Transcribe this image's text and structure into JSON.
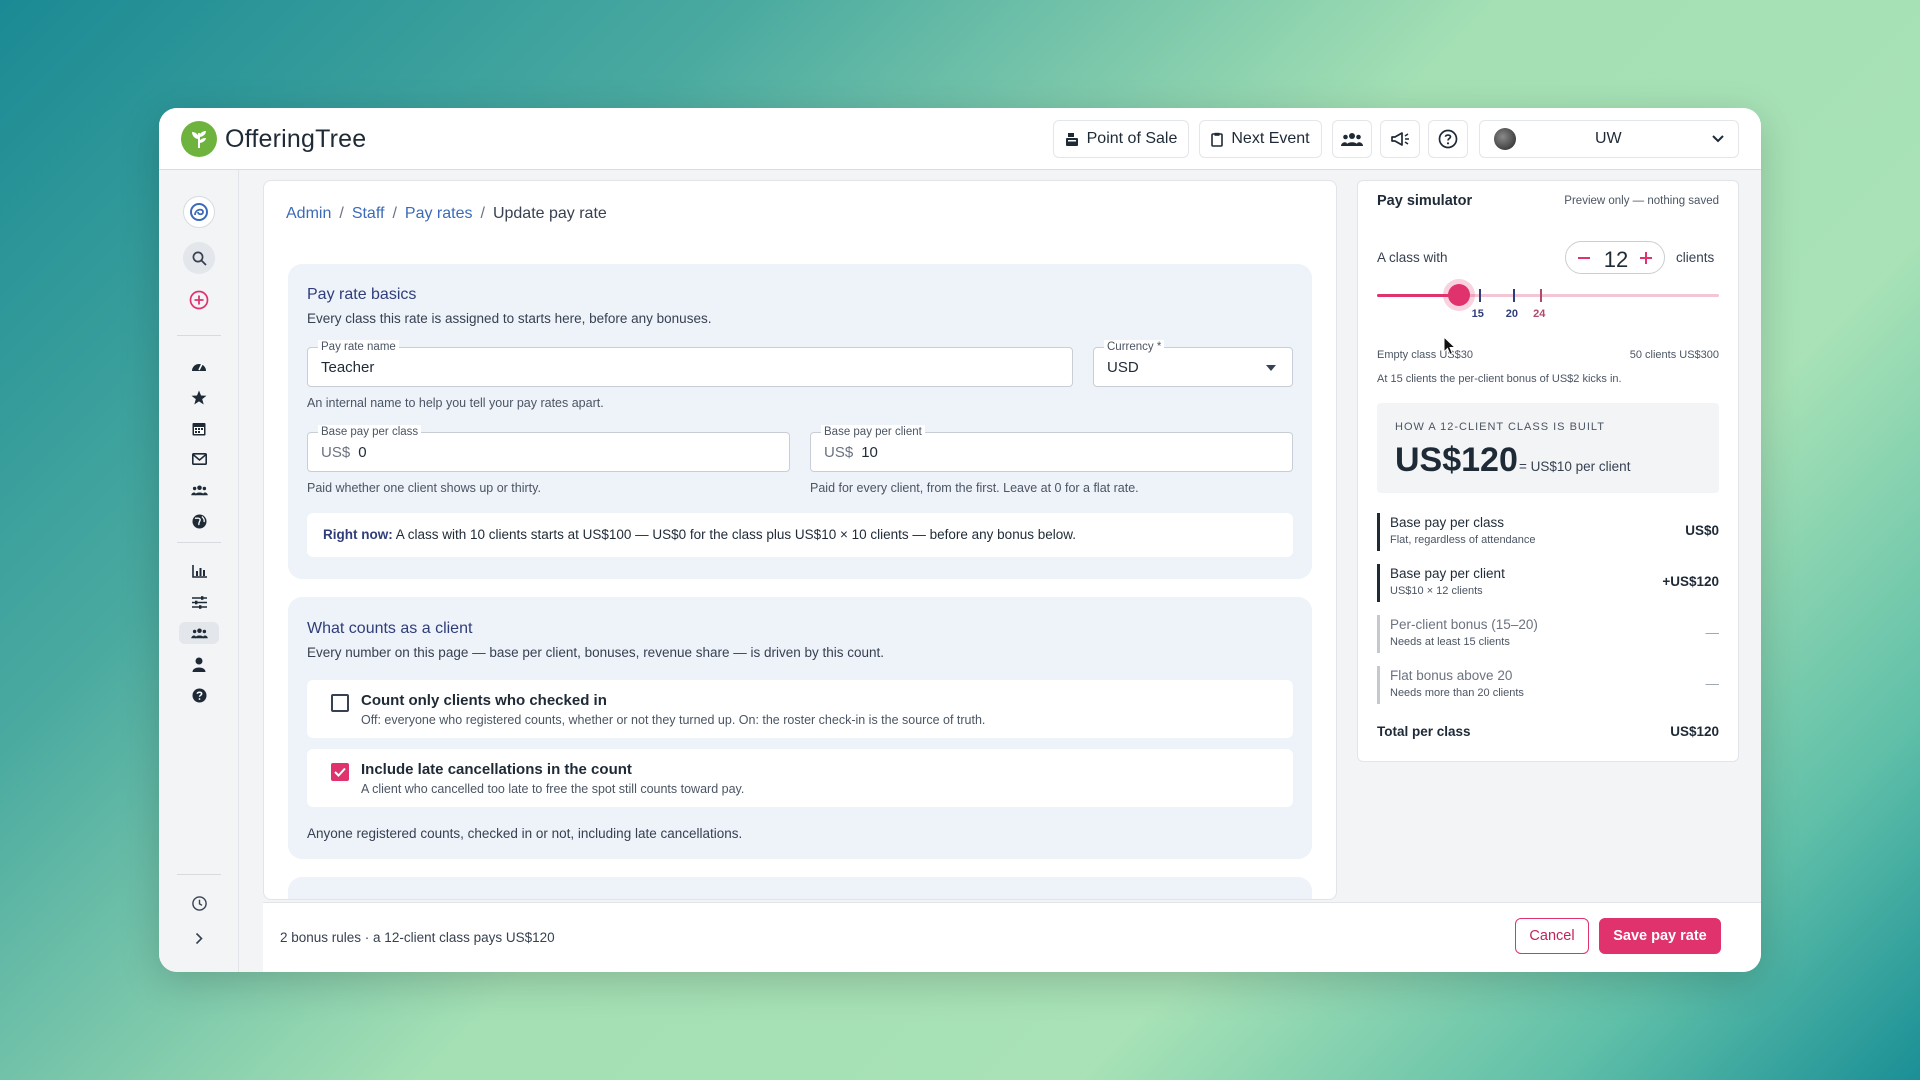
{
  "app": {
    "name": "OfferingTree"
  },
  "topbar": {
    "point_of_sale": "Point of Sale",
    "next_event": "Next Event",
    "user": "UW"
  },
  "breadcrumb": {
    "admin": "Admin",
    "staff": "Staff",
    "pay_rates": "Pay rates",
    "current": "Update pay rate"
  },
  "basics": {
    "title": "Pay rate basics",
    "subtitle": "Every class this rate is assigned to starts here, before any bonuses.",
    "name_label": "Pay rate name",
    "name_value": "Teacher",
    "name_help": "An internal name to help you tell your pay rates apart.",
    "currency_label": "Currency *",
    "currency_value": "USD",
    "base_class_label": "Base pay per class",
    "base_class_prefix": "US$",
    "base_class_value": "0",
    "base_class_help": "Paid whether one client shows up or thirty.",
    "base_client_label": "Base pay per client",
    "base_client_prefix": "US$",
    "base_client_value": "10",
    "base_client_help": "Paid for every client, from the first. Leave at 0 for a flat rate.",
    "right_now_label": "Right now:",
    "right_now_text": "A class with 10 clients starts at US$100 — US$0 for the class plus US$10 × 10 clients — before any bonus below."
  },
  "counts": {
    "title": "What counts as a client",
    "subtitle": "Every number on this page — base per client, bonuses, revenue share — is driven by this count.",
    "opt1_title": "Count only clients who checked in",
    "opt1_desc": "Off: everyone who registered counts, whether or not they turned up. On: the roster check-in is the source of truth.",
    "opt1_checked": false,
    "opt2_title": "Include late cancellations in the count",
    "opt2_desc": "A client who cancelled too late to free the spot still counts toward pay.",
    "opt2_checked": true,
    "footer": "Anyone registered counts, checked in or not, including late cancellations."
  },
  "bottom": {
    "summary": "2 bonus rules · a 12-client class pays US$120",
    "cancel": "Cancel",
    "save": "Save pay rate"
  },
  "simulator": {
    "title": "Pay simulator",
    "preview": "Preview only — nothing saved",
    "with_label": "A class with",
    "clients_label": "clients",
    "count": "12",
    "slider_min": 0,
    "slider_max": 50,
    "slider_value": 12,
    "ticks": [
      {
        "value": 15,
        "label": "15",
        "color": "#2f3e7a"
      },
      {
        "value": 20,
        "label": "20",
        "color": "#2f3e7a"
      },
      {
        "value": 24,
        "label": "24",
        "color": "#b04a6a"
      }
    ],
    "range_left": "Empty class US$30",
    "range_right": "50 clients US$300",
    "note": "At 15 clients the per-client bonus of US$2 kicks in.",
    "built_caption": "How a 12-client class is built",
    "built_total": "US$120",
    "built_per": "= US$10 per client",
    "lines": [
      {
        "title": "Base pay per class",
        "sub": "Flat, regardless of attendance",
        "amount": "US$0"
      },
      {
        "title": "Base pay per client",
        "sub": "US$10 × 12 clients",
        "amount": "+US$120"
      },
      {
        "title": "Per-client bonus (15–20)",
        "sub": "Needs at least 15 clients",
        "amount": "—"
      },
      {
        "title": "Flat bonus above 20",
        "sub": "Needs more than 20 clients",
        "amount": "—"
      }
    ],
    "total_label": "Total per class",
    "total_value": "US$120"
  },
  "colors": {
    "accent": "#e0336e",
    "heading": "#2f3e7a",
    "link": "#3b6bb8",
    "brand_green": "#6fb33f"
  }
}
